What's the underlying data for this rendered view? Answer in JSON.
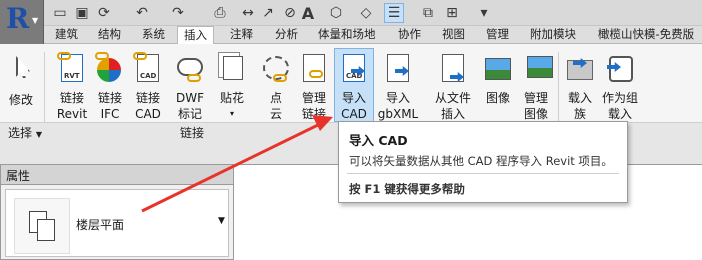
{
  "app_button": {
    "icon": "revit-logo",
    "dropdown": "▾"
  },
  "quick_access": [
    {
      "name": "open-icon",
      "glyph": "📂"
    },
    {
      "name": "save-icon",
      "glyph": "💾"
    },
    {
      "name": "sync-icon",
      "glyph": "⟳"
    },
    {
      "name": "undo-icon",
      "glyph": "↶"
    },
    {
      "name": "redo-icon",
      "glyph": "↷"
    },
    {
      "name": "print-icon",
      "glyph": "⎙"
    },
    {
      "name": "measure-icon",
      "glyph": "↔"
    },
    {
      "name": "dimension-icon",
      "glyph": "↗"
    },
    {
      "name": "tag-icon",
      "glyph": "⊘"
    },
    {
      "name": "text-icon",
      "glyph": "A"
    },
    {
      "name": "3d-view-icon",
      "glyph": "⬡"
    },
    {
      "name": "section-icon",
      "glyph": "◇"
    },
    {
      "name": "thin-lines-icon",
      "glyph": "☰"
    },
    {
      "name": "close-windows-icon",
      "glyph": "⧉"
    },
    {
      "name": "switch-windows-icon",
      "glyph": "⊞"
    },
    {
      "name": "customize-icon",
      "glyph": "▾"
    }
  ],
  "tabs": [
    "建筑",
    "结构",
    "系统",
    "插入",
    "注释",
    "分析",
    "体量和场地",
    "协作",
    "视图",
    "管理",
    "附加模块",
    "橄榄山快模-免费版"
  ],
  "active_tab": "插入",
  "ribbon": {
    "buttons": [
      {
        "label": "修改",
        "icon": "modify-icon"
      },
      {
        "label": "链接\nRevit",
        "icon": "link-revit-icon"
      },
      {
        "label": "链接\nIFC",
        "icon": "link-ifc-icon"
      },
      {
        "label": "链接\nCAD",
        "icon": "link-cad-icon"
      },
      {
        "label": "DWF\n标记",
        "icon": "dwf-markup-icon"
      },
      {
        "label": "贴花",
        "icon": "decal-icon"
      },
      {
        "label": "点\n云",
        "icon": "point-cloud-icon"
      },
      {
        "label": "管理\n链接",
        "icon": "manage-links-icon"
      },
      {
        "label": "导入\nCAD",
        "icon": "import-cad-icon"
      },
      {
        "label": "导入\ngbXML",
        "icon": "import-gbxml-icon"
      },
      {
        "label": "从文件\n插入",
        "icon": "insert-from-file-icon"
      },
      {
        "label": "图像",
        "icon": "image-icon"
      },
      {
        "label": "管理\n图像",
        "icon": "manage-images-icon"
      },
      {
        "label": "载入\n族",
        "icon": "load-family-icon"
      },
      {
        "label": "作为组\n载入",
        "icon": "load-as-group-icon"
      }
    ],
    "panel_titles": {
      "select": "选择",
      "link": "链接"
    },
    "doc_tags": {
      "rvt": "RVT",
      "cad": "CAD",
      "dwf": "DWF"
    }
  },
  "tooltip": {
    "title": "导入 CAD",
    "description": "可以将矢量数据从其他 CAD 程序导入 Revit 项目。",
    "help": "按 F1 键获得更多帮助"
  },
  "properties": {
    "title": "属性",
    "type_name": "楼层平面"
  },
  "colors": {
    "accent": "#1f6fc9",
    "highlight": "#c6e0f7",
    "annotation_arrow": "#e8332a"
  }
}
